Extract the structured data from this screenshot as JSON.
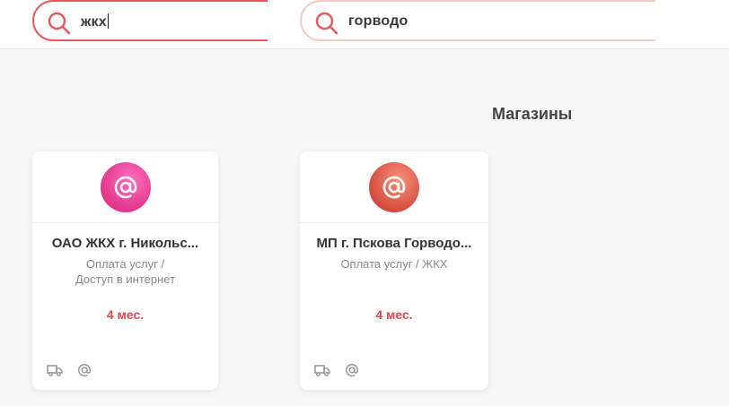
{
  "search": {
    "primary_query": "жкх",
    "secondary_query": "горводо"
  },
  "section": {
    "title": "Магазины"
  },
  "cards": [
    {
      "name": "ОАО ЖКХ г. Никольс...",
      "category": "Оплата услуг / Доступ в интернет",
      "term": "4 мес.",
      "logo_gradient": [
        "#e03a8c",
        "#ff5fb3"
      ],
      "icons": [
        "delivery-truck-icon",
        "at-sign-icon"
      ]
    },
    {
      "name": "МП г. Пскова Горводо...",
      "category": "Оплата услуг / ЖКХ",
      "term": "4 мес.",
      "logo_gradient": [
        "#d94b3c",
        "#f48b6e"
      ],
      "icons": [
        "delivery-truck-icon",
        "at-sign-icon"
      ]
    }
  ],
  "colors": {
    "accent": "#e8585c",
    "term_red": "#e0474c"
  }
}
